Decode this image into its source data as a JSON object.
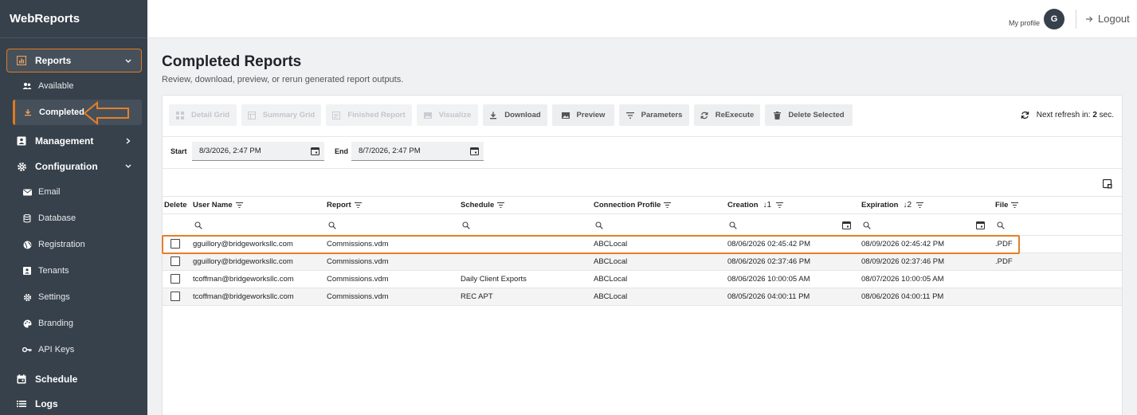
{
  "app": {
    "title": "WebReports"
  },
  "sidebar": {
    "items": [
      {
        "label": "Reports",
        "icon": "chart-icon"
      },
      {
        "label": "Available",
        "icon": "people-icon"
      },
      {
        "label": "Completed",
        "icon": "download-icon"
      },
      {
        "label": "Management",
        "icon": "id-card-icon"
      },
      {
        "label": "Configuration",
        "icon": "gear-icon"
      },
      {
        "label": "Email",
        "icon": "mail-icon"
      },
      {
        "label": "Database",
        "icon": "database-icon"
      },
      {
        "label": "Registration",
        "icon": "globe-icon"
      },
      {
        "label": "Tenants",
        "icon": "id-card-icon"
      },
      {
        "label": "Settings",
        "icon": "gear-icon"
      },
      {
        "label": "Branding",
        "icon": "palette-icon"
      },
      {
        "label": "API Keys",
        "icon": "key-icon"
      },
      {
        "label": "Schedule",
        "icon": "calendar-icon"
      },
      {
        "label": "Logs",
        "icon": "list-icon"
      }
    ]
  },
  "header": {
    "profile_label": "My profile",
    "avatar_initial": "G",
    "logout_label": "Logout"
  },
  "page": {
    "title": "Completed Reports",
    "subtitle": "Review, download, preview, or rerun generated report outputs."
  },
  "toolbar": {
    "buttons": [
      {
        "label": "Detail Grid",
        "enabled": false
      },
      {
        "label": "Summary Grid",
        "enabled": false
      },
      {
        "label": "Finished Report",
        "enabled": false
      },
      {
        "label": "Visualize",
        "enabled": false
      },
      {
        "label": "Download",
        "enabled": true
      },
      {
        "label": "Preview",
        "enabled": true
      },
      {
        "label": "Parameters",
        "enabled": true
      },
      {
        "label": "ReExecute",
        "enabled": true
      },
      {
        "label": "Delete Selected",
        "enabled": true
      }
    ],
    "refresh_prefix": "Next refresh in:",
    "refresh_count": "2",
    "refresh_suffix": "sec."
  },
  "filters": {
    "start_label": "Start",
    "start_value": "8/3/2026, 2:47 PM",
    "end_label": "End",
    "end_value": "8/7/2026, 2:47 PM"
  },
  "table": {
    "columns": [
      {
        "label": "Delete"
      },
      {
        "label": "User Name"
      },
      {
        "label": "Report"
      },
      {
        "label": "Schedule"
      },
      {
        "label": "Connection Profile"
      },
      {
        "label": "Creation",
        "sort": "↓1"
      },
      {
        "label": "Expiration",
        "sort": "↓2"
      },
      {
        "label": "File"
      }
    ],
    "rows": [
      {
        "user": "gguillory@bridgeworksllc.com",
        "report": "Commissions.vdm",
        "schedule": "",
        "profile": "ABCLocal",
        "creation": "08/06/2026 02:45:42 PM",
        "expiration": "08/09/2026 02:45:42 PM",
        "file": ".PDF"
      },
      {
        "user": "gguillory@bridgeworksllc.com",
        "report": "Commissions.vdm",
        "schedule": "",
        "profile": "ABCLocal",
        "creation": "08/06/2026 02:37:46 PM",
        "expiration": "08/09/2026 02:37:46 PM",
        "file": ".PDF"
      },
      {
        "user": "tcoffman@bridgeworksllc.com",
        "report": "Commissions.vdm",
        "schedule": "Daily Client Exports",
        "profile": "ABCLocal",
        "creation": "08/06/2026 10:00:05 AM",
        "expiration": "08/07/2026 10:00:05 AM",
        "file": ""
      },
      {
        "user": "tcoffman@bridgeworksllc.com",
        "report": "Commissions.vdm",
        "schedule": "REC APT",
        "profile": "ABCLocal",
        "creation": "08/05/2026 04:00:11 PM",
        "expiration": "08/06/2026 04:00:11 PM",
        "file": ""
      }
    ]
  },
  "colors": {
    "accent": "#e57f27",
    "sidebar": "#37414b"
  }
}
